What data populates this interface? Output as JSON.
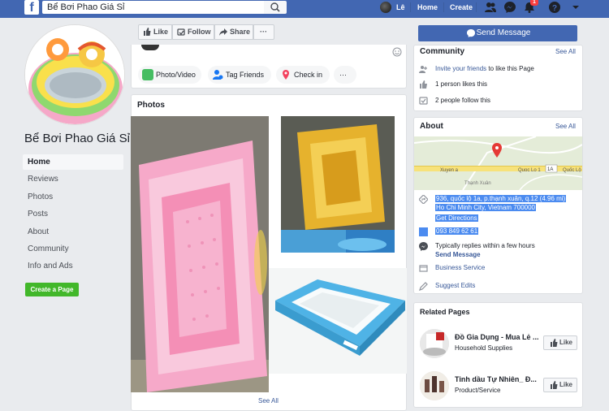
{
  "topbar": {
    "search_value": "Bể Bơi Phao Giá Sỉ",
    "user_name": "Lê",
    "home": "Home",
    "create": "Create",
    "notification_count": "1"
  },
  "left": {
    "page_name": "Bể Bơi Phao Giá Sỉ",
    "nav": [
      "Home",
      "Reviews",
      "Photos",
      "Posts",
      "About",
      "Community",
      "Info and Ads"
    ],
    "create_page": "Create a Page"
  },
  "actions": {
    "like": "Like",
    "follow": "Follow",
    "share": "Share",
    "more": "···"
  },
  "composer": {
    "photo_video": "Photo/Video",
    "tag_friends": "Tag Friends",
    "check_in": "Check in",
    "more": "···"
  },
  "photos": {
    "title": "Photos",
    "see_all": "See All"
  },
  "right": {
    "send_message": "Send Message",
    "community": {
      "title": "Community",
      "see_all": "See All",
      "invite_link": "Invite your friends",
      "invite_rest": " to like this Page",
      "likes": "1 person likes this",
      "follows": "2 people follow this"
    },
    "about": {
      "title": "About",
      "see_all": "See All",
      "map_labels": {
        "road1": "Xuyen a",
        "road2": "Quoc Lo 1",
        "road_badge": "1A",
        "road3": "Quốc Lộ",
        "area": "Thạnh Xuân"
      },
      "address1": "936, quốc lộ 1a, p.thạnh xuân, q.12 (4.96 mi)",
      "address2": "Ho Chi Minh City, Vietnam 700000",
      "directions": "Get Directions",
      "phone": "093 849 62 61",
      "replies": "Typically replies within a few hours",
      "send_message": "Send Message",
      "category": "Business Service",
      "suggest": "Suggest Edits"
    },
    "related": {
      "title": "Related Pages",
      "pages": [
        {
          "name": "Đồ Gia Dụng - Mua Lẻ ...",
          "category": "Household Supplies",
          "like": "Like"
        },
        {
          "name": "Tinh dầu Tự Nhiên_ Đ...",
          "category": "Product/Service",
          "like": "Like"
        }
      ]
    }
  },
  "colors": {
    "brand": "#4267b2",
    "link": "#385898",
    "green": "#42b72a"
  }
}
